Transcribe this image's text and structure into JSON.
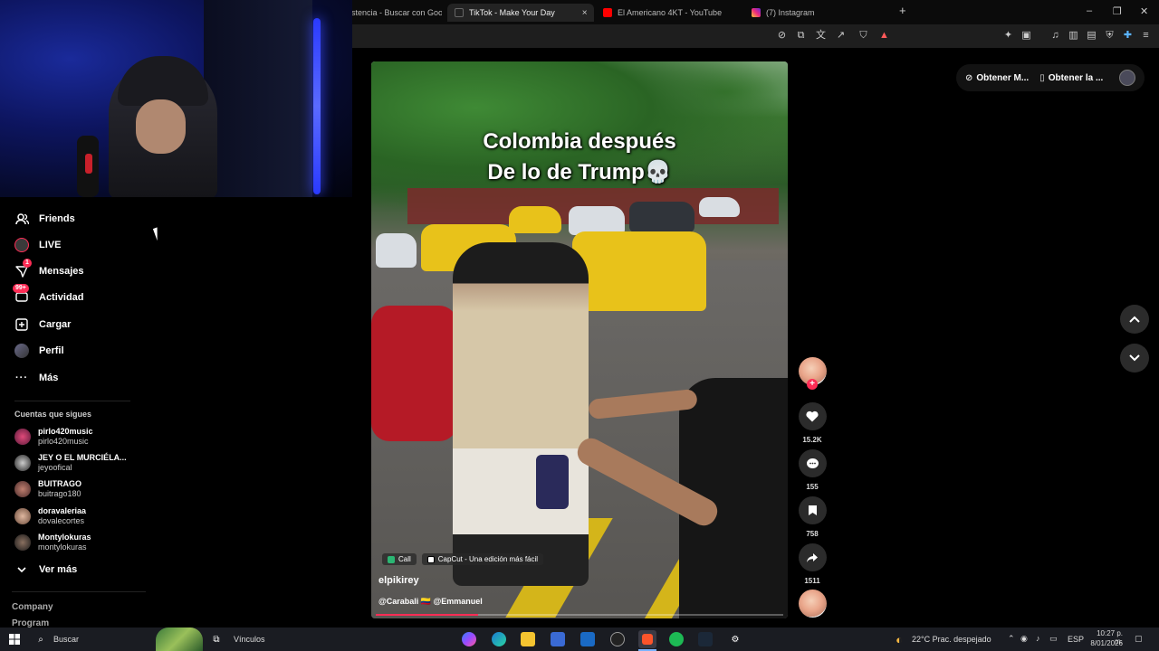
{
  "browser": {
    "tabs": [
      {
        "title": "stencia - Buscar con Googl",
        "icon": "google-icon",
        "color": "#4285f4"
      },
      {
        "title": "TikTok - Make Your Day",
        "icon": "tiktok-icon",
        "color": "#111111"
      },
      {
        "title": "El Americano 4KT - YouTube",
        "icon": "youtube-icon",
        "color": "#ff0000"
      },
      {
        "title": "(7) Instagram",
        "icon": "instagram-icon",
        "color": "#d62976"
      }
    ],
    "close_tab": "×",
    "new_tab": "+",
    "window": {
      "minimize": "–",
      "restore": "❐",
      "close": "✕"
    }
  },
  "topbar": {
    "get_app_1": "Obtener M...",
    "get_app_2": "Obtener la ..."
  },
  "sidebar": {
    "items": [
      {
        "label": "Friends",
        "icon": "friends-icon",
        "glyph": "👥"
      },
      {
        "label": "LIVE",
        "icon": "live-icon",
        "glyph": "●"
      },
      {
        "label": "Mensajes",
        "icon": "messages-icon",
        "glyph": "▽",
        "badge": "1"
      },
      {
        "label": "Actividad",
        "icon": "activity-icon",
        "glyph": "▢",
        "badge": "99+"
      },
      {
        "label": "Cargar",
        "icon": "upload-icon",
        "glyph": "⊞"
      },
      {
        "label": "Perfil",
        "icon": "profile-icon",
        "glyph": "●"
      },
      {
        "label": "Más",
        "icon": "more-icon",
        "glyph": "···"
      }
    ],
    "following_title": "Cuentas que sigues",
    "accounts": [
      {
        "name": "pirlo420music",
        "username": "pirlo420music",
        "color": "#8b2a4a"
      },
      {
        "name": "JEY O EL MURCIÉLA...",
        "username": "jeyoofical",
        "color": "#333333"
      },
      {
        "name": "BUITRAGO",
        "username": "buitrago180",
        "color": "#6a3a3a"
      },
      {
        "name": "doravaleriaa",
        "username": "dovalecortes",
        "color": "#8a6a5a"
      },
      {
        "name": "Montylokuras",
        "username": "montylokuras",
        "color": "#3a3a3a"
      }
    ],
    "see_more": "Ver más",
    "footer": [
      "Company",
      "Program"
    ]
  },
  "video": {
    "overlay_title_line1": "Colombia después",
    "overlay_title_line2": "De lo de Trump💀",
    "anchor_1": "Call",
    "anchor_2": "CapCut - Una edición más fácil",
    "author": "elpikirey",
    "caption": "@Carabali 🇨🇴 @Emmanuel",
    "progress": 0.25
  },
  "actions": {
    "like_count": "15.2K",
    "comment_count": "155",
    "save_count": "758",
    "share_count": "1511",
    "follow": "+"
  },
  "taskbar": {
    "search": "Buscar",
    "vinculos": "Vínculos",
    "weather": "22°C  Prac. despejado",
    "lang": "ESP",
    "time": "10:27 p. m.",
    "date": "8/01/2026"
  }
}
